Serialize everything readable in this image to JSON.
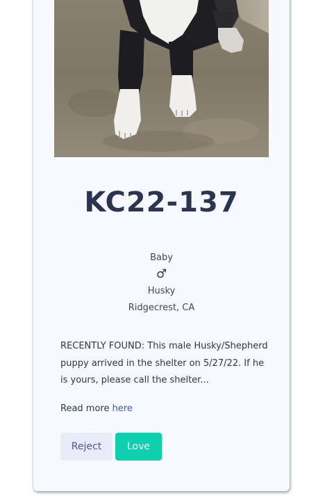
{
  "pet": {
    "name": "KC22-137",
    "age": "Baby",
    "gender_symbol": "♂",
    "breed": "Husky",
    "location": "Ridgecrest, CA",
    "description": "RECENTLY FOUND: This male Husky/Shepherd puppy arrived in the shelter on 5/27/22. If he is yours, please call the shelter...",
    "photo_icon": "puppy-photo"
  },
  "read_more": {
    "prefix": "Read more ",
    "link_label": "here"
  },
  "actions": {
    "reject_label": "Reject",
    "love_label": "Love"
  },
  "colors": {
    "accent_love": "#0fcfb1",
    "accent_reject_bg": "#e9ecf8",
    "text_primary": "#2b3552",
    "link": "#3e55c9"
  }
}
